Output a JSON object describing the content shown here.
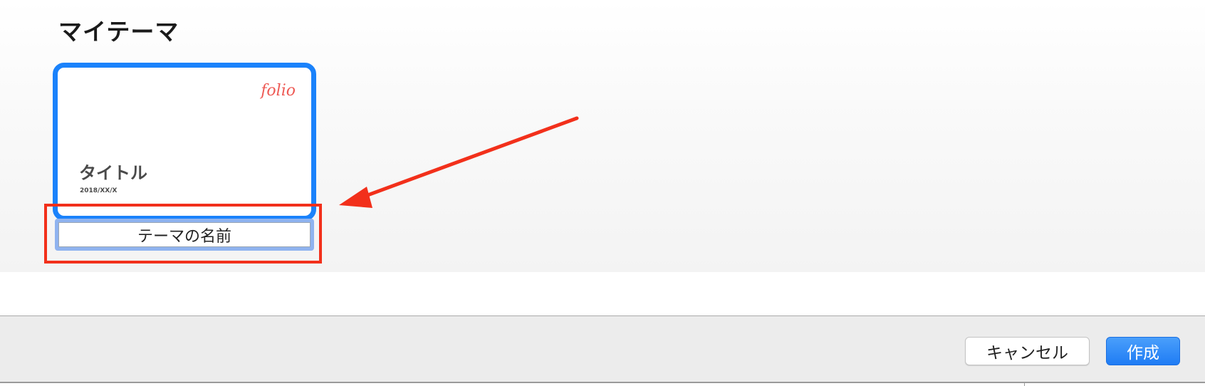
{
  "section": {
    "title": "マイテーマ"
  },
  "theme_card": {
    "logo": "folio",
    "title": "タイトル",
    "date": "2018/XX/X",
    "selected": true
  },
  "name_field": {
    "value": "テーマの名前"
  },
  "footer": {
    "cancel_label": "キャンセル",
    "create_label": "作成"
  },
  "colors": {
    "selection_border": "#1a82fb",
    "logo": "#ee5a55",
    "annotation": "#f2301b",
    "primary_button": "#1f7cf4"
  },
  "icons": {
    "annotation_arrow": "arrow-icon"
  }
}
